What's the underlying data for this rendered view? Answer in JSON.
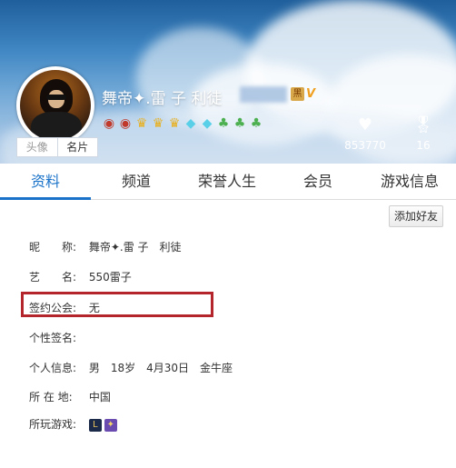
{
  "profile": {
    "nickname": "舞帝✦.雷 子   利徒",
    "vip_badge": "黑",
    "v_badge": "V",
    "avatar_tabs": [
      "头像",
      "名片"
    ],
    "likes": "853770",
    "medals_count": "16"
  },
  "tabs": [
    "资料",
    "频道",
    "荣誉人生",
    "会员",
    "游戏信息"
  ],
  "add_friend": "添加好友",
  "info": {
    "nickname_label": "昵　　称:",
    "nickname_value": "舞帝✦.雷 子　利徒",
    "stage_label": "艺　　名:",
    "stage_value": "550雷子",
    "guild_label": "签约公会:",
    "guild_value": "无",
    "signature_label": "个性签名:",
    "signature_value": "",
    "personal_label": "个人信息:",
    "personal_value": "男　18岁　4月30日　金牛座",
    "location_label": "所 在 地:",
    "location_value": "中国",
    "games_label": "所玩游戏:"
  }
}
